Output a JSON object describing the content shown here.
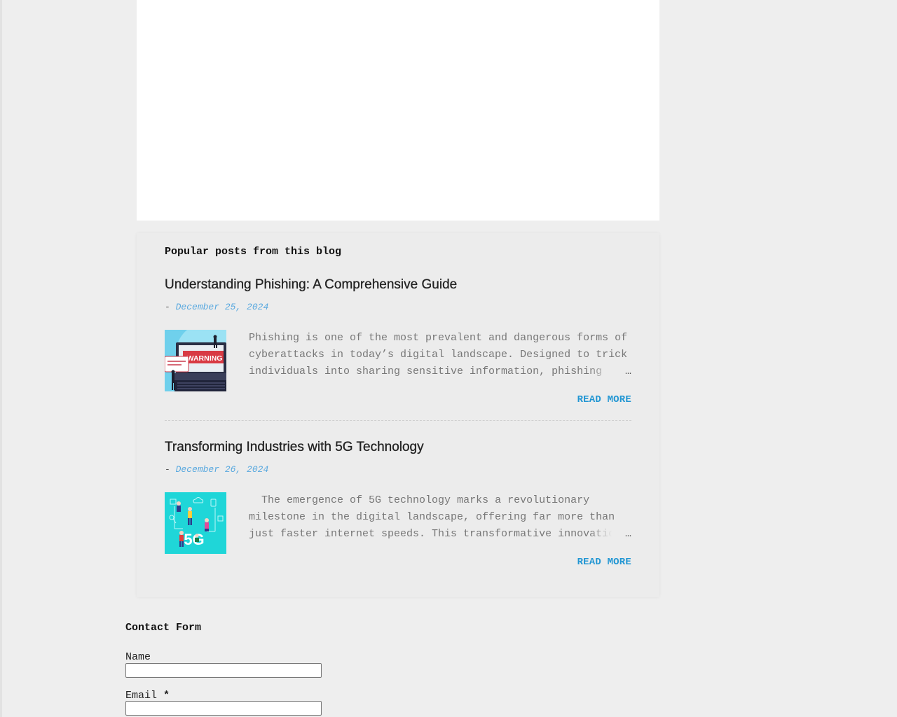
{
  "popular": {
    "heading": "Popular posts from this blog",
    "posts": [
      {
        "title": "Understanding Phishing: A Comprehensive Guide",
        "date_prefix": "-",
        "date": "December 25, 2024",
        "thumb_text": "WARNING",
        "snippet": "Phishing is one of the most prevalent and dangerous forms of cyberattacks in today’s digital landscape. Designed to trick individuals into sharing sensitive information, phishing",
        "ellipsis": "…",
        "read_more": "READ MORE"
      },
      {
        "title": "Transforming Industries with 5G Technology",
        "date_prefix": "-",
        "date": "December 26, 2024",
        "thumb_text": "5G",
        "snippet": "  The emergence of 5G technology marks a revolutionary milestone in the digital landscape, offering far more than just faster internet speeds. This transformative innovation",
        "ellipsis": "…",
        "read_more": "READ MORE"
      }
    ]
  },
  "contact": {
    "heading": "Contact Form",
    "name_label": "Name",
    "email_label": "Email",
    "required_mark": "*",
    "name_value": "",
    "email_value": ""
  },
  "colors": {
    "page_bg": "#eeeeee",
    "link_blue": "#2196d3",
    "date_blue": "#5aa9df"
  }
}
